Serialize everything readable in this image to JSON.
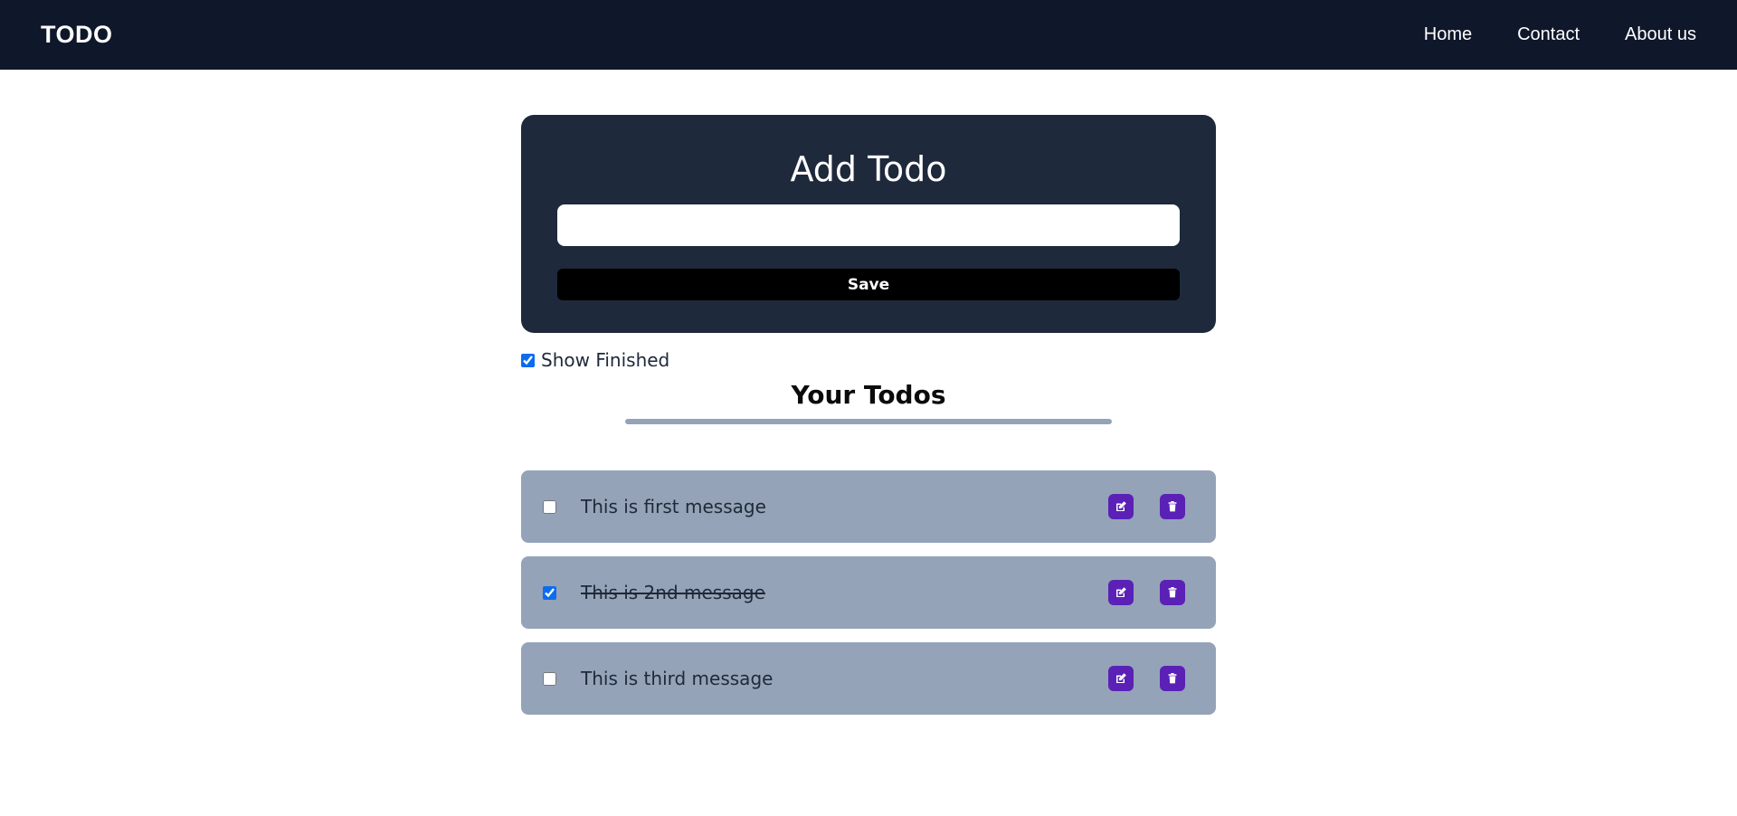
{
  "navbar": {
    "brand": "TODO",
    "links": [
      "Home",
      "Contact",
      "About us"
    ]
  },
  "add_card": {
    "title": "Add Todo",
    "input_value": "",
    "save_label": "Save"
  },
  "show_finished": {
    "label": "Show Finished",
    "checked": true
  },
  "section_title": "Your Todos",
  "todos": [
    {
      "text": "This is first message",
      "completed": false,
      "edit_icon": "edit-icon",
      "delete_icon": "trash-icon"
    },
    {
      "text": "This is 2nd message",
      "completed": true,
      "edit_icon": "edit-icon",
      "delete_icon": "trash-icon"
    },
    {
      "text": "This is third message",
      "completed": false,
      "edit_icon": "edit-icon",
      "delete_icon": "trash-icon"
    }
  ],
  "colors": {
    "navbar_bg": "#0f172a",
    "card_bg": "#1e293b",
    "item_bg": "#94a3b8",
    "action_button": "#5b21b6",
    "save_button": "#000000"
  }
}
